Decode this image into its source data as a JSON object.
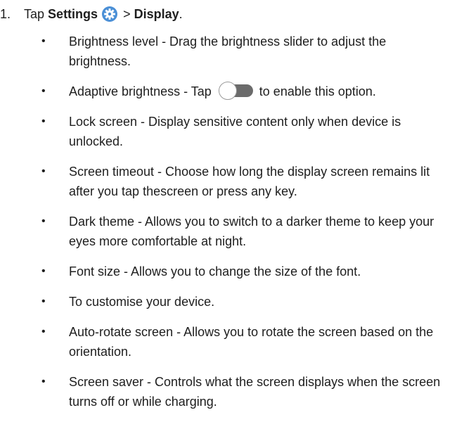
{
  "step": {
    "number": "1.",
    "prefix": "Tap",
    "settings": "Settings",
    "separator": ">",
    "display": "Display",
    "end": ".",
    "icon": "settings-gear-icon"
  },
  "options": [
    {
      "text": "Brightness level - Drag the brightness slider to adjust the brightness."
    },
    {
      "before": "Adaptive brightness - Tap",
      "after": "to enable this option.",
      "icon": "toggle-switch-icon"
    },
    {
      "text": "Lock screen - Display sensitive content only when device is unlocked."
    },
    {
      "text": "Screen timeout - Choose how long the display screen remains lit after you tap thescreen or press any key."
    },
    {
      "text": "Dark theme - Allows you to switch to a darker theme to keep your eyes more comfortable at night."
    },
    {
      "text": "Font size - Allows you to change the size of the font."
    },
    {
      "text": "To customise your device."
    },
    {
      "text": "Auto-rotate screen - Allows you to rotate the screen based on the orientation."
    },
    {
      "text": "Screen saver - Controls what the screen displays when the screen turns off or while charging."
    }
  ],
  "bullet": "•",
  "colors": {
    "text": "#1e1e1e",
    "gear_fill": "#4a8fd6",
    "toggle_track": "#6b6b6b"
  }
}
